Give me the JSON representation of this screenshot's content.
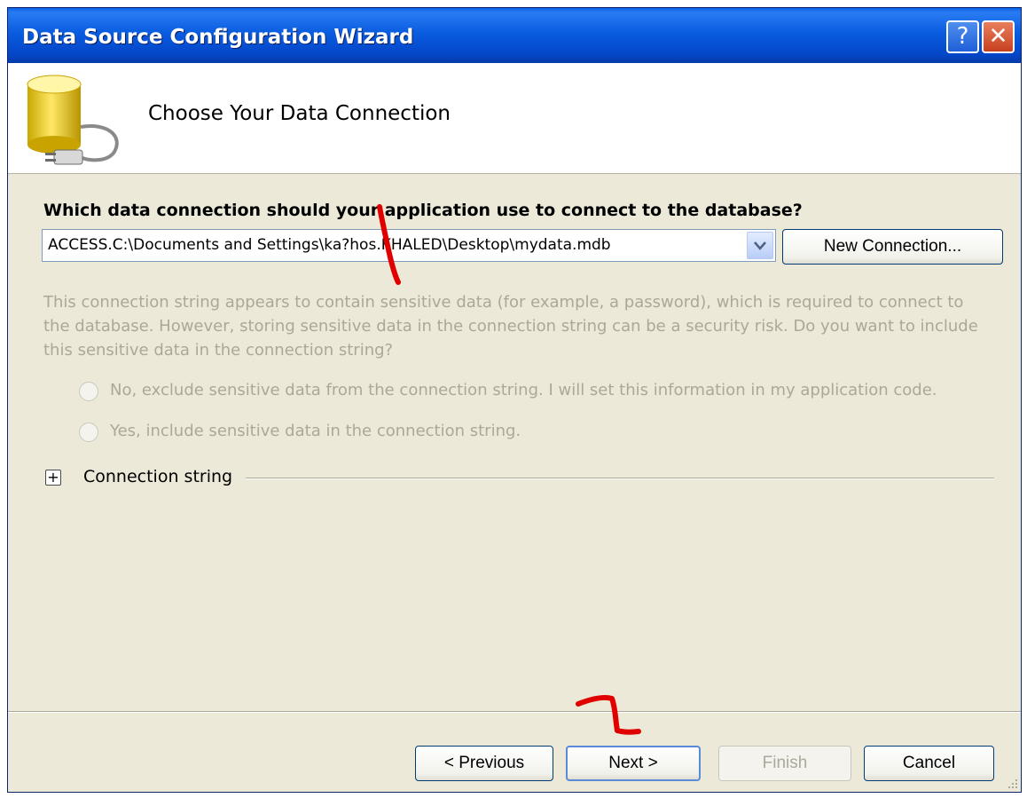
{
  "window": {
    "title": "Data Source Configuration Wizard",
    "help_symbol": "?",
    "close_symbol": "✕"
  },
  "header": {
    "title": "Choose Your Data Connection",
    "icon": "database-plug-icon"
  },
  "connection": {
    "question": "Which data connection should your application use to connect to the database?",
    "selected_value": "ACCESS.C:\\Documents and Settings\\ka?hos.KHALED\\Desktop\\mydata.mdb",
    "new_connection_label": "New Connection..."
  },
  "sensitive": {
    "message": "This connection string appears to contain sensitive data (for example, a password), which is required to connect to the database. However, storing sensitive data in the connection string can be a security risk. Do you want to include this sensitive data in the connection string?",
    "option_no": "No, exclude sensitive data from the connection string. I will set this information in my application code.",
    "option_yes": "Yes, include sensitive data in the connection string."
  },
  "connection_string": {
    "expander_symbol": "+",
    "label": "Connection string"
  },
  "buttons": {
    "previous": "< Previous",
    "next": "Next >",
    "finish": "Finish",
    "cancel": "Cancel"
  },
  "colors": {
    "titlebar": "#0a5ce0",
    "dialog_bg": "#ece9d8",
    "disabled_text": "#aca899",
    "annotation_red": "#e00000"
  }
}
